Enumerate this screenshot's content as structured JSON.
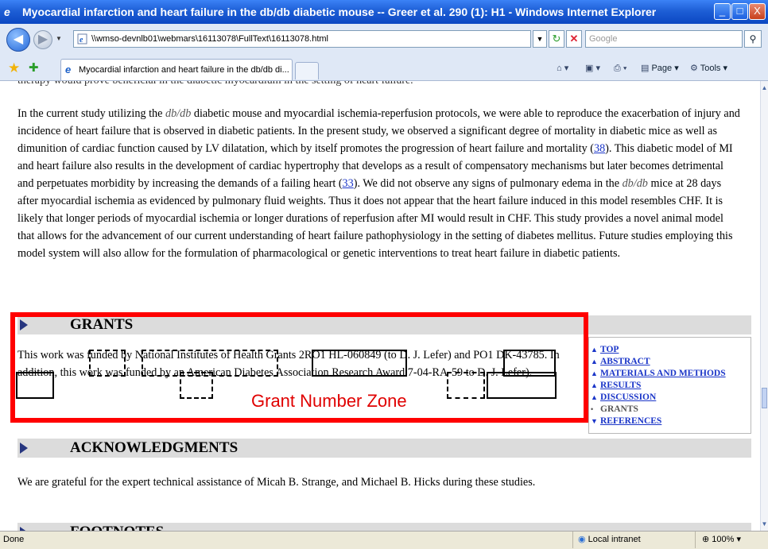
{
  "window": {
    "title": "Myocardial infarction and heart failure in the db/db diabetic mouse -- Greer et al. 290 (1): H1 - Windows Internet Explorer",
    "min_label": "_",
    "max_label": "□",
    "close_label": "X"
  },
  "address_bar": {
    "url": "\\\\wmso-devnlb01\\webmars\\16113078\\FullText\\16113078.html",
    "search_placeholder": "Google"
  },
  "tabs": [
    {
      "label": "Myocardial infarction and heart failure in the db/db di..."
    }
  ],
  "command_bar": {
    "page_label": "Page",
    "tools_label": "Tools"
  },
  "content": {
    "cut_line": "therapy would prove beneficial in the diabetic myocardium in the setting of heart failure.",
    "para": {
      "p1": "In the current study utilizing the ",
      "p1_ital": "db/db",
      "p2": " diabetic mouse and myocardial ischemia-reperfusion protocols, we were able to reproduce the exacerbation of injury and incidence of heart failure that is observed in diabetic patients. In the present study, we observed a significant degree of mortality in diabetic mice as well as dimunition of cardiac function caused by LV dilatation, which by itself promotes the progression of heart failure and mortality (",
      "ref1": "38",
      "p3": "). This diabetic model of MI and heart failure also results in the development of cardiac hypertrophy that develops as a result of compensatory mechanisms but later becomes detrimental and perpetuates morbidity by increasing the demands of a failing heart (",
      "ref2": "33",
      "p4": "). We did not observe any signs of pulmonary edema in the ",
      "p4_ital": "db/db",
      "p5": " mice at 28 days after myocardial ischemia as evidenced by pulmonary fluid weights. Thus it does not appear that the heart failure induced in this model resembles CHF. It is likely that longer periods of myocardial ischemia or longer durations of reperfusion after MI would result in CHF. This study provides a novel animal model that allows for the advancement of our current understanding of heart failure pathophysiology in the setting of diabetes mellitus. Future studies employing this model system will also allow for the formulation of pharmacological or genetic interventions to treat heart failure in diabetic patients."
    },
    "grants": {
      "heading": "GRANTS",
      "text": "This work was funded by National Institutes of Health Grants 2RO1 HL-060849 (to D. J. Lefer) and PO1 DK-43785. In addition, this work was funded by an American Diabetes Association Research Award 7-04-RA-59 to D. J. Lefer).",
      "zone_label": "Grant Number Zone"
    },
    "acknowledgments": {
      "heading": "ACKNOWLEDGMENTS",
      "text": "We are grateful for the expert technical assistance of Micah B. Strange, and Michael B. Hicks during these studies."
    },
    "footnotes": {
      "heading": "FOOTNOTES"
    },
    "toc": [
      {
        "label": "TOP",
        "arrow": "▲"
      },
      {
        "label": "ABSTRACT",
        "arrow": "▲"
      },
      {
        "label": "MATERIALS AND METHODS",
        "arrow": "▲"
      },
      {
        "label": "RESULTS",
        "arrow": "▲"
      },
      {
        "label": "DISCUSSION",
        "arrow": "▲"
      },
      {
        "label": "GRANTS",
        "arrow": "•"
      },
      {
        "label": "REFERENCES",
        "arrow": "▼"
      }
    ]
  },
  "status_bar": {
    "status": "Done",
    "zone": "Local intranet",
    "zoom": "100%"
  },
  "colors": {
    "highlight_box": "#ff0000",
    "link": "#1a35c8",
    "section_bar": "#dcdcdc"
  }
}
